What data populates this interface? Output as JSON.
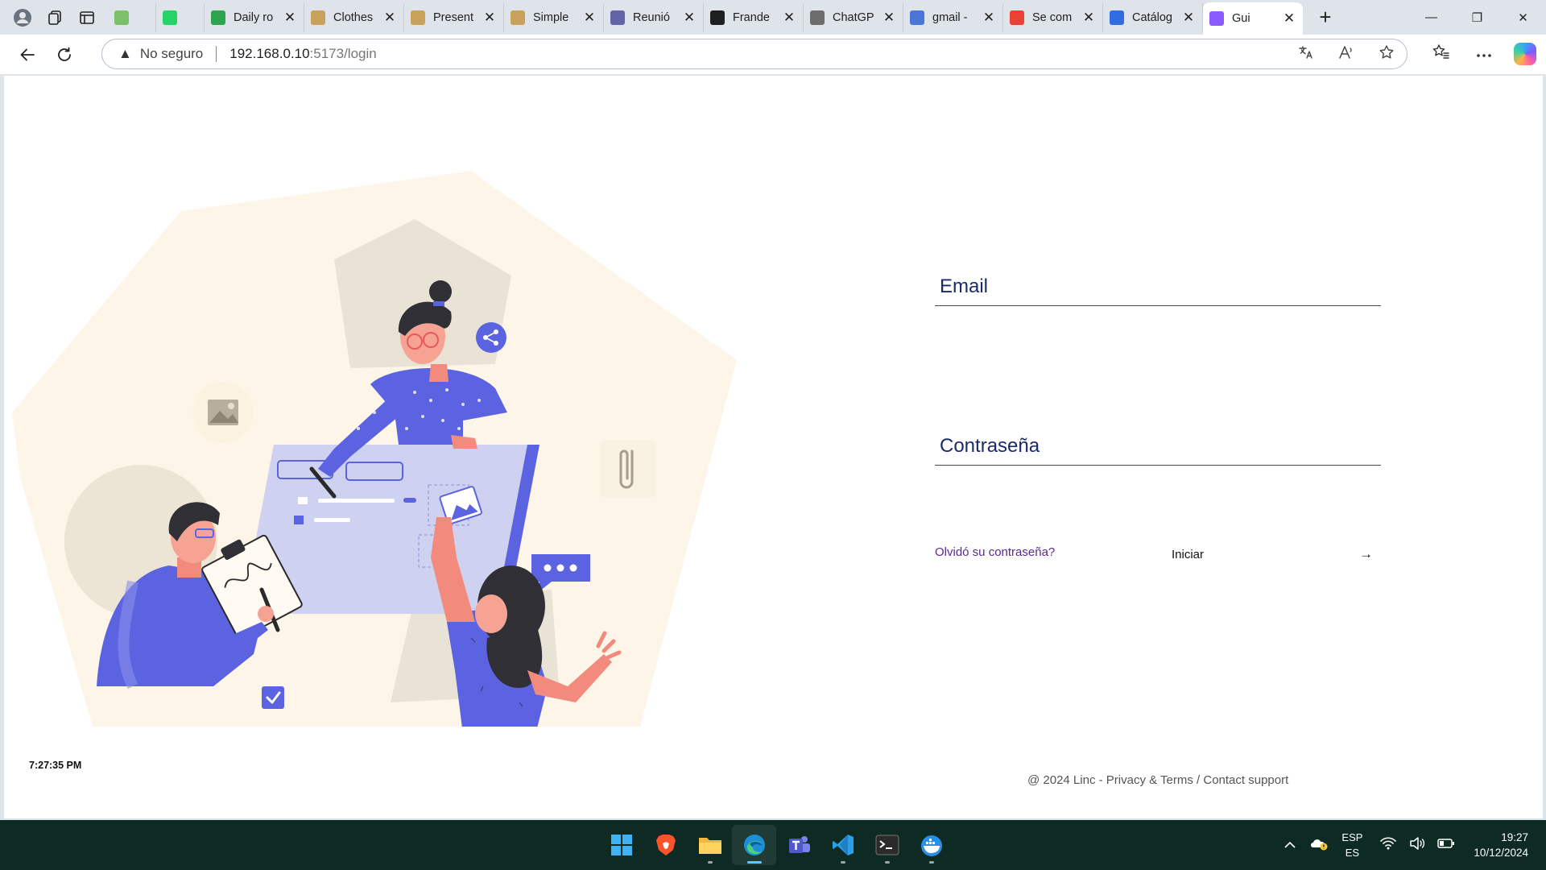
{
  "browser": {
    "tabs": [
      {
        "title": "",
        "favicon_color": "#7cc06a",
        "icon": "maps-icon",
        "short": true
      },
      {
        "title": "",
        "favicon_color": "#25d366",
        "icon": "whatsapp-icon",
        "short": true
      },
      {
        "title": "Daily ro",
        "favicon_color": "#2ea44f",
        "icon": "check-icon"
      },
      {
        "title": "Clothes",
        "favicon_color": "#c8a25a",
        "icon": "doc-icon"
      },
      {
        "title": "Present",
        "favicon_color": "#c8a25a",
        "icon": "doc-icon"
      },
      {
        "title": "Simple",
        "favicon_color": "#c8a25a",
        "icon": "doc-icon"
      },
      {
        "title": "Reunió",
        "favicon_color": "#6264a7",
        "icon": "teams-icon"
      },
      {
        "title": "Frande",
        "favicon_color": "#1f1f1f",
        "icon": "github-icon"
      },
      {
        "title": "ChatGP",
        "favicon_color": "#6d6d6d",
        "icon": "chatgpt-icon"
      },
      {
        "title": "gmail -",
        "favicon_color": "#4a76d8",
        "icon": "search-icon"
      },
      {
        "title": "Se com",
        "favicon_color": "#ea4335",
        "icon": "gmail-icon"
      },
      {
        "title": "Catálog",
        "favicon_color": "#2f6de1",
        "icon": "docs-icon"
      },
      {
        "title": "Gui",
        "favicon_color": "#8a5cff",
        "icon": "vite-icon",
        "active": true
      }
    ],
    "tab_close": "✕",
    "new_tab": "+",
    "window_controls": {
      "minimize": "—",
      "maximize": "❐",
      "close": "✕"
    },
    "address": {
      "security_label": "No seguro",
      "host": "192.168.0.10",
      "path": ":5173/login"
    }
  },
  "login": {
    "email_label": "Email",
    "password_label": "Contraseña",
    "forgot_link": "Olvidó su contraseña?",
    "submit_label": "Iniciar",
    "submit_arrow": "→"
  },
  "page_clock": "7:27:35 PM",
  "footer": {
    "copyright": "@ 2024 Linc - ",
    "privacy_link": "Privacy & Terms",
    "divider": " / ",
    "support_link": "Contact support"
  },
  "taskbar": {
    "apps": [
      "windows-start-icon",
      "brave-icon",
      "file-explorer-icon",
      "edge-icon",
      "teams-icon",
      "vscode-icon",
      "terminal-icon",
      "docker-icon"
    ],
    "lang_top": "ESP",
    "lang_bottom": "ES",
    "time": "19:27",
    "date": "10/12/2024"
  },
  "colors": {
    "label_blue": "#1b2a6b",
    "link_purple": "#5b2a91",
    "illustration_purple": "#5b63e0",
    "illustration_bg": "#fdf6e8",
    "taskbar_bg": "#0d2b23"
  }
}
